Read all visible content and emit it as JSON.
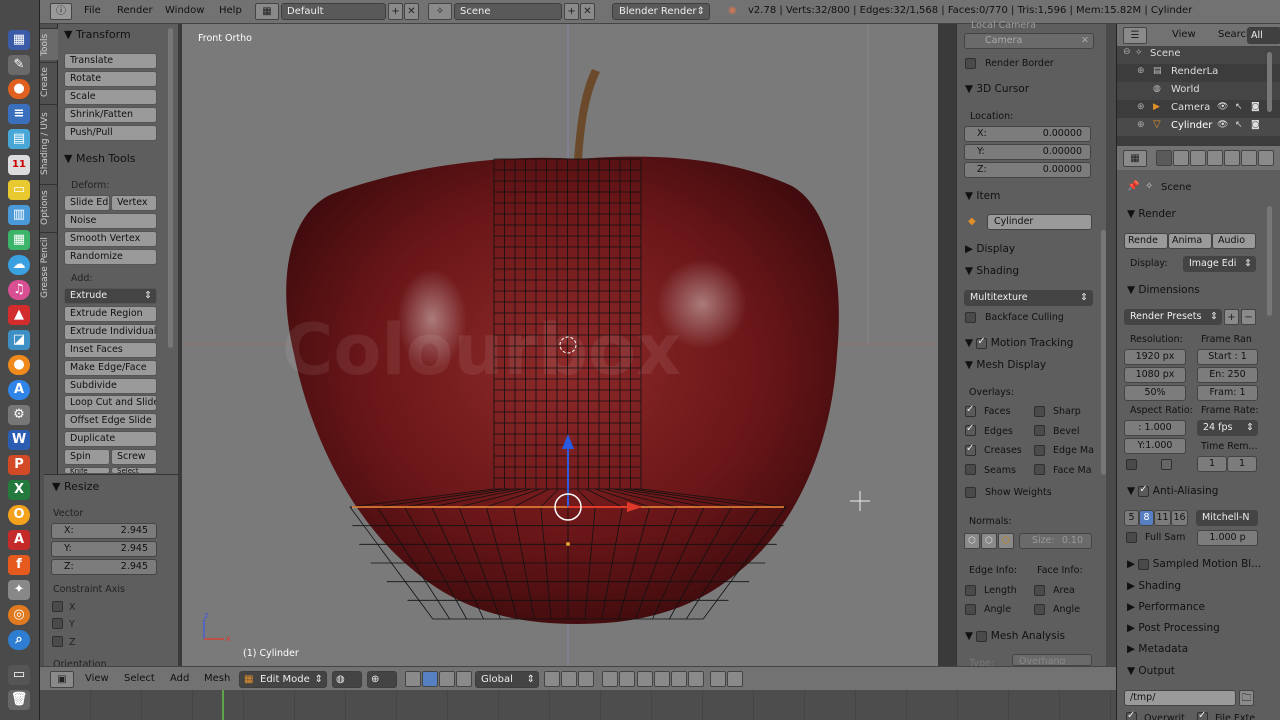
{
  "launcher": {
    "icons": [
      "files-icon",
      "settings-icon",
      "firefox-icon",
      "writer-icon",
      "photos-icon",
      "calendar-icon",
      "notes-icon",
      "calc-icon",
      "spreadsheet-icon",
      "chat-icon",
      "steam-icon",
      "music-icon",
      "red-app-icon",
      "image-app-icon",
      "orange-app-icon",
      "appstore-icon",
      "settings-gear-icon",
      "word-icon",
      "powerpoint-icon",
      "excel-icon",
      "circle-app-icon",
      "acrobat-icon",
      "font-app-icon",
      "tools-icon",
      "sync-icon",
      "search-icon",
      "blender-icon",
      "trash-icon"
    ]
  },
  "topbar": {
    "menus": [
      "File",
      "Render",
      "Window",
      "Help"
    ],
    "layout": "Default",
    "scene": "Scene",
    "engine": "Blender Render",
    "stats": "v2.78 | Verts:32/800 | Edges:32/1,568 | Faces:0/770 | Tris:1,596 | Mem:15.82M | Cylinder"
  },
  "tooltabs": [
    "Tools",
    "Create",
    "Shading / UVs",
    "Options",
    "Grease Pencil"
  ],
  "tools": {
    "transform_title": "Transform",
    "transform": [
      "Translate",
      "Rotate",
      "Scale",
      "Shrink/Fatten",
      "Push/Pull"
    ],
    "meshtools_title": "Mesh Tools",
    "deform_label": "Deform:",
    "slide_edge": "Slide Ed",
    "vertex": "Vertex",
    "noise": "Noise",
    "smooth_vertex": "Smooth Vertex",
    "randomize": "Randomize",
    "add_label": "Add:",
    "extrude": "Extrude",
    "add": [
      "Extrude Region",
      "Extrude Individual",
      "Inset Faces",
      "Make Edge/Face",
      "Subdivide",
      "Loop Cut and Slide",
      "Offset Edge Slide",
      "Duplicate"
    ],
    "spin": "Spin",
    "screw": "Screw",
    "knife": "Knife",
    "select": "Select"
  },
  "resize": {
    "title": "Resize",
    "vector_label": "Vector",
    "x_label": "X:",
    "x": "2.945",
    "y_label": "Y:",
    "y": "2.945",
    "z_label": "Z:",
    "z": "2.945",
    "constraint_label": "Constraint Axis",
    "axes": [
      "X",
      "Y",
      "Z"
    ],
    "orientation_label": "Orientation"
  },
  "viewport": {
    "view_label": "Front Ortho",
    "object_label": "(1) Cylinder",
    "watermark": "Colourbox"
  },
  "npanel": {
    "local_camera": "Local Camera",
    "camera": "Camera",
    "render_border": "Render Border",
    "cursor_title": "3D Cursor",
    "location_label": "Location:",
    "cx_label": "X:",
    "cx": "0.00000",
    "cy_label": "Y:",
    "cy": "0.00000",
    "cz_label": "Z:",
    "cz": "0.00000",
    "item_title": "Item",
    "item_name": "Cylinder",
    "display_title": "Display",
    "shading_title": "Shading",
    "shading_mode": "Multitexture",
    "backface": "Backface Culling",
    "motion_title": "Motion Tracking",
    "mesh_display_title": "Mesh Display",
    "overlays_label": "Overlays:",
    "overlays_left": [
      "Faces",
      "Edges",
      "Creases",
      "Seams"
    ],
    "overlays_right": [
      "Sharp",
      "Bevel",
      "Edge Ma",
      "Face Ma"
    ],
    "show_weights": "Show Weights",
    "normals_label": "Normals:",
    "size_label": "Size:",
    "size": "0.10",
    "edge_info": "Edge Info:",
    "face_info": "Face Info:",
    "length": "Length",
    "area": "Area",
    "angle1": "Angle",
    "angle2": "Angle",
    "mesh_analysis": "Mesh Analysis",
    "type_label": "Type:",
    "type_value": "Overhang"
  },
  "outliner": {
    "view": "View",
    "search": "Search",
    "all_scenes": "All Sce",
    "items": [
      "Scene",
      "RenderLa",
      "World",
      "Camera",
      "Cylinder"
    ]
  },
  "props": {
    "scene": "Scene",
    "render_title": "Render",
    "render_btns": [
      "Rende",
      "Anima",
      "Audio"
    ],
    "display_label": "Display:",
    "display_value": "Image Edi",
    "dimensions_title": "Dimensions",
    "presets": "Render Presets",
    "resolution_label": "Resolution:",
    "frame_range_label": "Frame Ran",
    "res_x": "1920 px",
    "res_y": "1080 px",
    "res_pct": "50%",
    "start": "Start : 1",
    "end": "En: 250",
    "frame": "Fram: 1",
    "aspect_label": "Aspect Ratio:",
    "framerate_label": "Frame Rate:",
    "aspect_x": ": 1.000",
    "aspect_y": "Y:1.000",
    "fps": "24 fps",
    "time_rem": "Time Rem...",
    "t1": "1",
    "t2": "1",
    "aa_title": "Anti-Aliasing",
    "aa_samples": [
      "5",
      "8",
      "11",
      "16"
    ],
    "aa_filter": "Mitchell-N",
    "full_sample": "Full Sam",
    "filter_size": "1.000 p",
    "sampled_motion": "Sampled Motion Bl...",
    "collapsed": [
      "Shading",
      "Performance",
      "Post Processing",
      "Metadata"
    ],
    "output_title": "Output",
    "output_path": "/tmp/",
    "overwrite": "Overwrit",
    "file_ext": "File Exte"
  },
  "bottombar": {
    "menus": [
      "View",
      "Select",
      "Add",
      "Mesh"
    ],
    "mode": "Edit Mode",
    "orientation": "Global"
  }
}
